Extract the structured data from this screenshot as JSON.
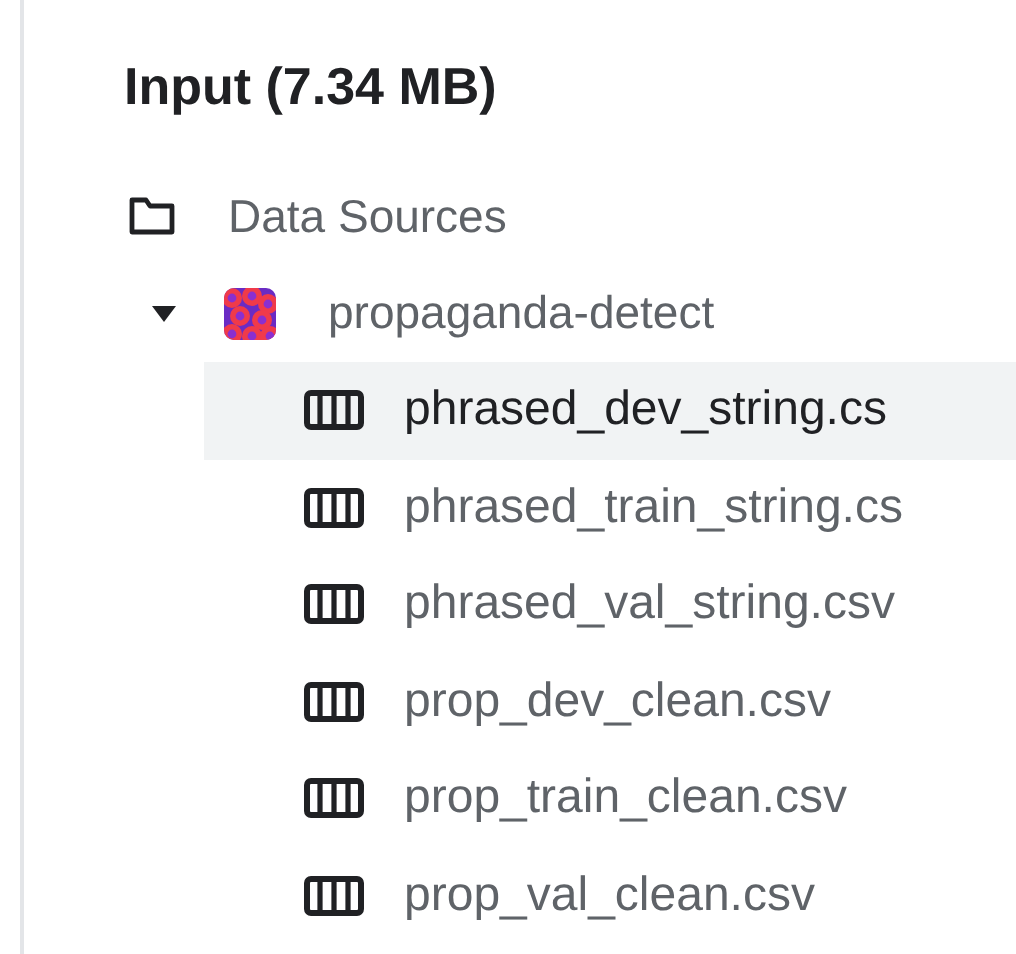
{
  "title": "Input (7.34 MB)",
  "tree": [
    {
      "label": "Data Sources",
      "kind": "folder",
      "children": [
        {
          "label": "propaganda-detect",
          "kind": "dataset",
          "expanded": true,
          "children": [
            {
              "label": "phrased_dev_string.cs",
              "kind": "table",
              "selected": true
            },
            {
              "label": "phrased_train_string.cs",
              "kind": "table",
              "selected": false
            },
            {
              "label": "phrased_val_string.csv",
              "kind": "table",
              "selected": false
            },
            {
              "label": "prop_dev_clean.csv",
              "kind": "table",
              "selected": false
            },
            {
              "label": "prop_train_clean.csv",
              "kind": "table",
              "selected": false
            },
            {
              "label": "prop_val_clean.csv",
              "kind": "table",
              "selected": false
            }
          ]
        }
      ]
    }
  ]
}
